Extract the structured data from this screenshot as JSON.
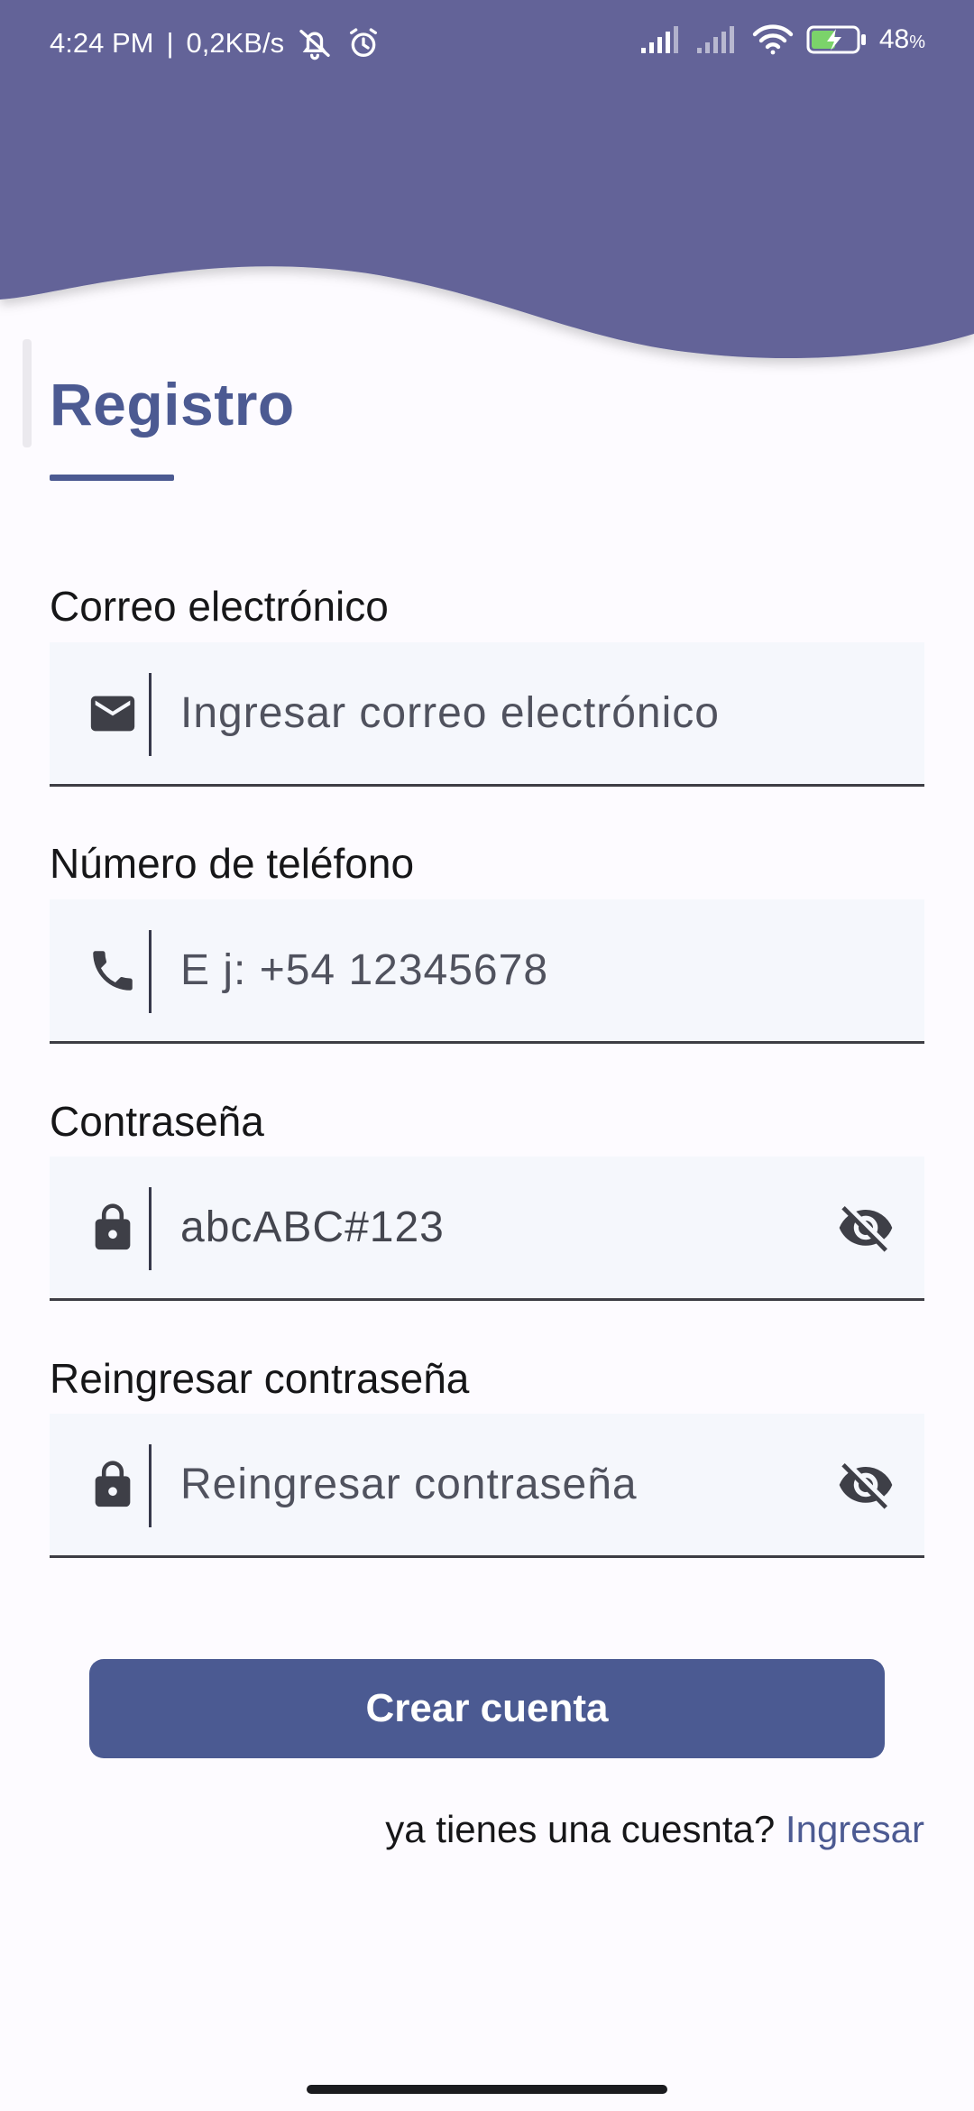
{
  "status_bar": {
    "time": "4:24 PM",
    "separator": "|",
    "speed": "0,2KB/s",
    "battery_percent": "48",
    "battery_unit": "%",
    "icons": [
      "notifications-off-icon",
      "alarm-icon",
      "signal-icon",
      "signal-icon",
      "wifi-icon",
      "battery-charging-icon"
    ]
  },
  "theme": {
    "header_color": "#636398",
    "accent_color": "#4c5a92",
    "field_background": "#f5f7fc"
  },
  "page": {
    "title": "Registro"
  },
  "form": {
    "email": {
      "label": "Correo electrónico",
      "placeholder": "Ingresar correo electrónico",
      "value": "",
      "icon": "mail-icon"
    },
    "phone": {
      "label": "Número de teléfono",
      "placeholder": "E j: +54 12345678",
      "value": "",
      "icon": "phone-icon"
    },
    "password": {
      "label": "Contraseña",
      "placeholder": "",
      "value": "abcABC#123",
      "icon": "lock-icon",
      "toggle_icon": "visibility-off-icon"
    },
    "confirm_password": {
      "label": "Reingresar contraseña",
      "placeholder": "Reingresar contraseña",
      "value": "",
      "icon": "lock-icon",
      "toggle_icon": "visibility-off-icon"
    }
  },
  "actions": {
    "create_account_label": "Crear cuenta",
    "login_prompt": "ya tienes una cuesnta?",
    "login_link": "Ingresar"
  }
}
